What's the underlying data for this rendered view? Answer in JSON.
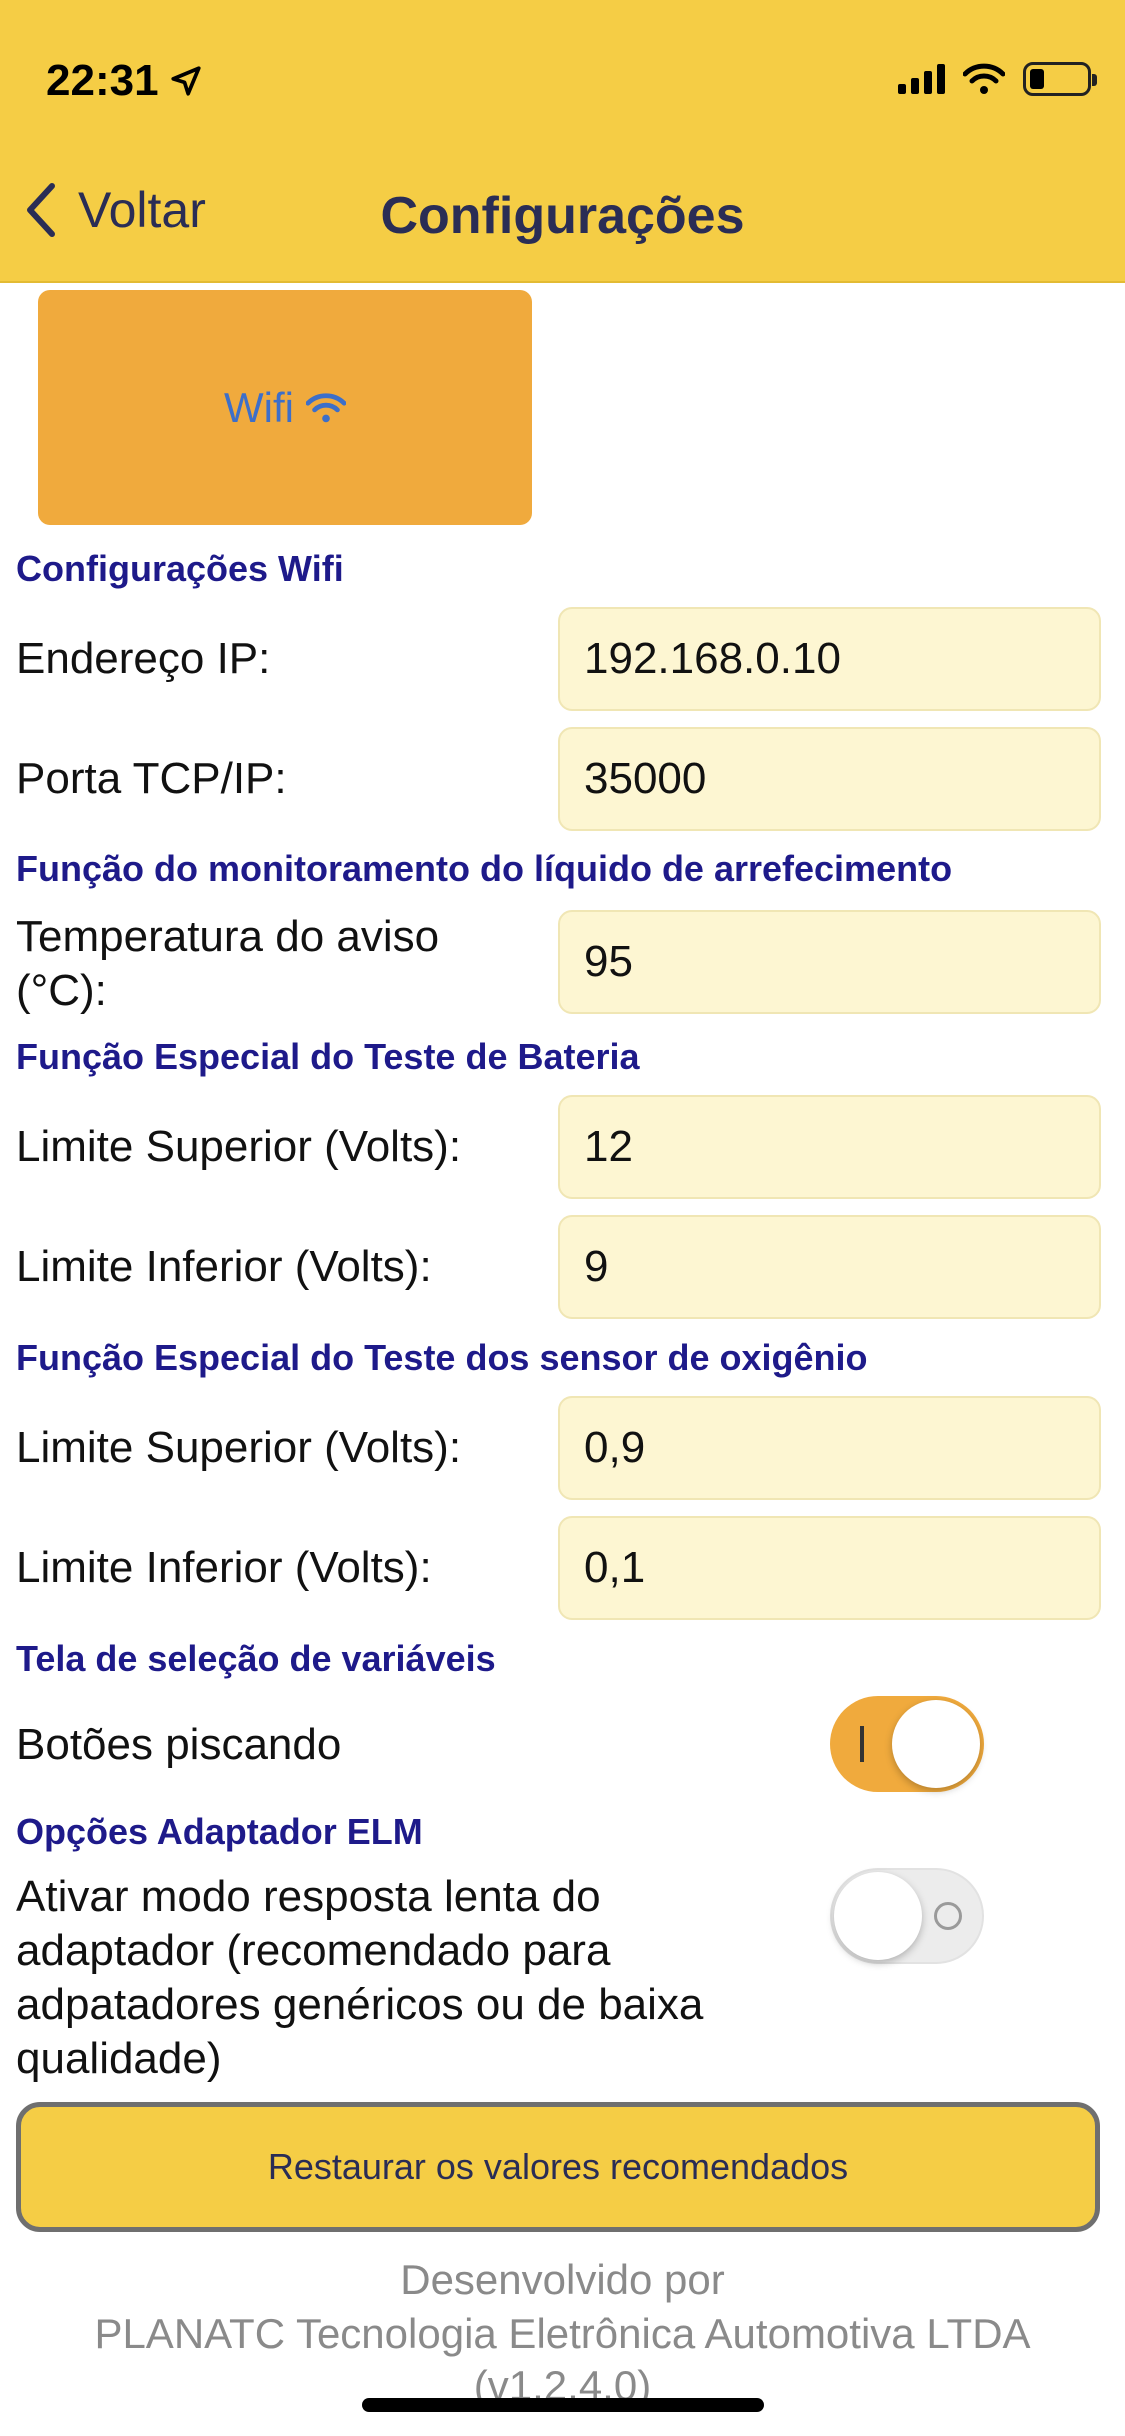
{
  "status_bar": {
    "time": "22:31",
    "icons": [
      "location-arrow-icon",
      "signal-icon",
      "wifi-icon",
      "battery-icon"
    ]
  },
  "nav": {
    "back_label": "Voltar",
    "title": "Configurações"
  },
  "wifi_button": {
    "label": "Wifi",
    "icon": "wifi-icon"
  },
  "sections": {
    "wifi": {
      "title": "Configurações Wifi",
      "ip_label": "Endereço IP:",
      "ip_value": "192.168.0.10",
      "port_label": "Porta TCP/IP:",
      "port_value": "35000"
    },
    "coolant": {
      "title": "Função do monitoramento do líquido de arrefecimento",
      "warning_temp_label_line1": "Temperatura do aviso",
      "warning_temp_label_line2": "(°C):",
      "warning_temp_value": "95"
    },
    "battery": {
      "title": "Função Especial do Teste de Bateria",
      "upper_label": "Limite Superior (Volts):",
      "upper_value": "12",
      "lower_label": "Limite Inferior (Volts):",
      "lower_value": "9"
    },
    "oxygen": {
      "title": "Função Especial do Teste dos sensor de oxigênio",
      "upper_label": "Limite Superior (Volts):",
      "upper_value": "0,9",
      "lower_label": "Limite Inferior (Volts):",
      "lower_value": "0,1"
    },
    "variables": {
      "title": "Tela de seleção de variáveis",
      "blink_label": "Botões piscando",
      "blink_on": true
    },
    "elm": {
      "title": "Opções Adaptador ELM",
      "slow_mode_line1": "Ativar modo resposta lenta do",
      "slow_mode_line2": "adaptador (recomendado para",
      "slow_mode_line3": "adpatadores genéricos ou de baixa",
      "slow_mode_line4": "qualidade)",
      "slow_mode_on": false
    }
  },
  "restore_button": "Restaurar os valores recomendados",
  "footer": {
    "line1": "Desenvolvido por",
    "line2": "PLANATC Tecnologia Eletrônica Automotiva LTDA",
    "line3": "(v1.2.4.0)"
  },
  "colors": {
    "header": "#F5CD45",
    "accent_orange": "#F0AA3D",
    "section_title": "#1E1A8A",
    "field_bg": "#FDF6D2"
  }
}
